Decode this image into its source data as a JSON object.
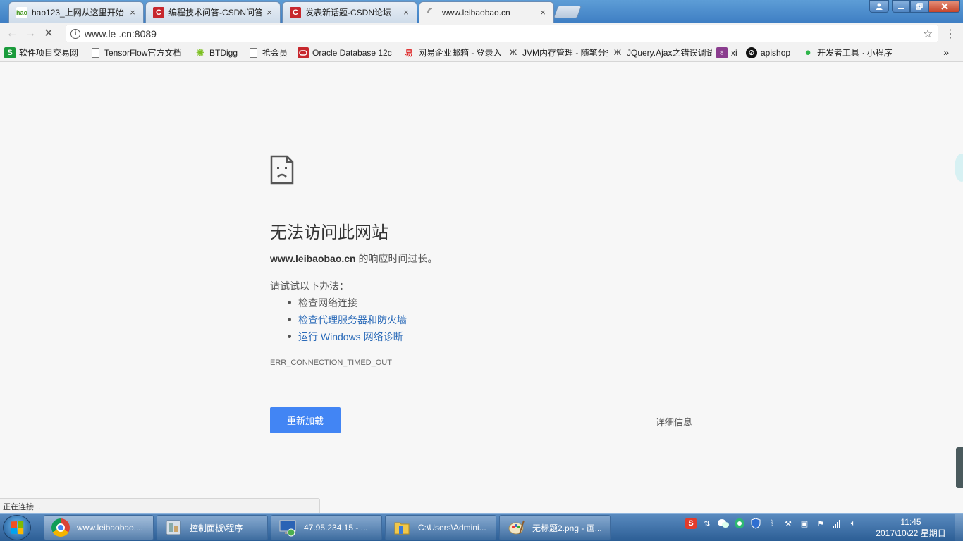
{
  "tabs": [
    {
      "title": "hao123_上网从这里开始",
      "close": "×"
    },
    {
      "title": "编程技术问答-CSDN问答",
      "close": "×"
    },
    {
      "title": "发表新话题-CSDN论坛",
      "close": "×"
    },
    {
      "title": "www.leibaobao.cn",
      "close": "×"
    }
  ],
  "toolbar": {
    "back": "←",
    "forward": "→",
    "stop": "✕",
    "url": "www.le        .cn:8089",
    "star": "☆",
    "menu": "⋮"
  },
  "bookmarks": [
    {
      "label": "软件项目交易网",
      "icon": "s-icon",
      "color": "#1a9b3b",
      "glyph": "S"
    },
    {
      "label": "TensorFlow官方文档",
      "icon": "page-icon",
      "color": "",
      "glyph": ""
    },
    {
      "label": "BTDigg",
      "icon": "btdigg-icon",
      "color": "#7bbf1e",
      "glyph": "✺"
    },
    {
      "label": "抢会员",
      "icon": "page-icon",
      "color": "",
      "glyph": ""
    },
    {
      "label": "Oracle Database 12c",
      "icon": "oracle-icon",
      "color": "#c7272d",
      "glyph": "▭"
    },
    {
      "label": "网易企业邮箱 - 登录入口",
      "icon": "netease-icon",
      "color": "#d22",
      "glyph": "易"
    },
    {
      "label": "JVM内存管理 - 随笔分类",
      "icon": "jvm-icon",
      "color": "#555",
      "glyph": "Ж"
    },
    {
      "label": "JQuery.Ajax之错误调试",
      "icon": "jquery-icon",
      "color": "#555",
      "glyph": "Ж"
    },
    {
      "label": "xi",
      "icon": "xi-icon",
      "color": "#8a3c8e",
      "glyph": "♁"
    },
    {
      "label": "apishop",
      "icon": "apishop-icon",
      "color": "#111",
      "glyph": "⊘"
    },
    {
      "label": "开发者工具 · 小程序",
      "icon": "wechat-icon",
      "color": "#2fb54a",
      "glyph": "●"
    }
  ],
  "bookmarks_more": "»",
  "error": {
    "title": "无法访问此网站",
    "host": "www.leibaobao.cn",
    "desc_suffix": " 的响应时间过长。",
    "suggest_head": "请试试以下办法：",
    "suggestions": [
      "检查网络连接",
      "检查代理服务器和防火墙",
      "运行 Windows 网络诊断"
    ],
    "code": "ERR_CONNECTION_TIMED_OUT",
    "reload": "重新加载",
    "details": "详细信息"
  },
  "status": "正在连接...",
  "taskbar": {
    "items": [
      {
        "label": "www.leibaobao...."
      },
      {
        "label": "控制面板\\程序"
      },
      {
        "label": "47.95.234.15 - ..."
      },
      {
        "label": "C:\\Users\\Admini..."
      },
      {
        "label": "无标题2.png - 画..."
      }
    ],
    "time": "11:45",
    "date": "2017\\10\\22 星期日"
  },
  "colors": {
    "accent": "#4285f4",
    "link": "#2a6ab8"
  }
}
